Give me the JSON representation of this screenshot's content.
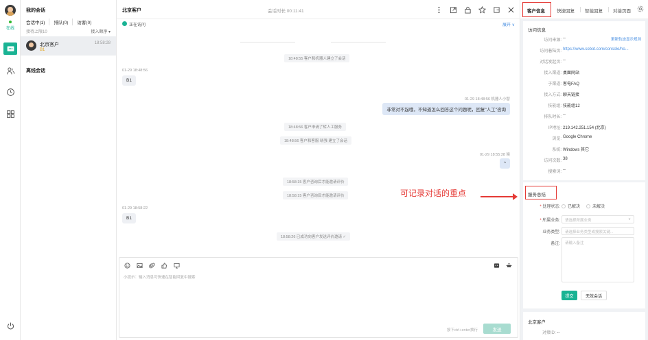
{
  "nav": {
    "status_label": "在线"
  },
  "conversations": {
    "title": "我的会话",
    "tabs": [
      "会话中(1)",
      "排队(0)",
      "访客(0)"
    ],
    "limit": "接待上限10",
    "sort": "接入顺序 ▾",
    "items": [
      {
        "name": "北京客户",
        "message": "B1",
        "time": "18:58:28"
      }
    ],
    "history_title": "离线会话"
  },
  "chat": {
    "customer_name": "北京客户",
    "duration": "会话时长 00:11:41",
    "visit_status": "正在访问",
    "expand": "展开 ∨",
    "separator": "以下为本次消息",
    "messages": {
      "sys1": "18:48:55 客户和机器人建立了会话",
      "ts1": "01-29 18:48:56",
      "b1": "B1",
      "ts_robot": "01-29 18:48:56  机器人小智",
      "robot_msg": "非常对不起哦，不知道怎么回答这个问题呢，回复\"人工\"咨询",
      "sys2": "18:48:56 客户申请了转人工服务",
      "sys3": "18:48:56 客户和客服 晓强 建立了会话",
      "ts_agent": "01-29 18:55:28  晓",
      "agent_msg": "*",
      "sys4": "18:58:15 客户咨询后才能邀请评价",
      "sys5": "18:58:15 客户咨询后才能邀请评价",
      "ts2": "01-29 18:58:22",
      "b2": "B1",
      "sys6": "18:58:26 已成功向客户发送评价邀请 ✓"
    },
    "input_hint": "小提示：输入消息可快速在智能回复中搜索",
    "send_hint": "按下ctrl+enter换行",
    "send_label": "发送"
  },
  "annotation": "可记录对话的重点",
  "right_panel": {
    "tabs": [
      "客户信息",
      "快捷回复",
      "智能回复",
      "对接页面"
    ],
    "visit_title": "访问信息",
    "visit_link": "更新轨迹显示规则",
    "visit_rows": [
      {
        "label": "访问来源:",
        "value": "--"
      },
      {
        "label": "访问着陆页:",
        "value": "https://www.sobot.com/console/ho..."
      },
      {
        "label": "对话发起页:",
        "value": "--"
      },
      {
        "label": "接入渠道:",
        "value": "桌面网站"
      },
      {
        "label": "子渠道:",
        "value": "客电FAQ"
      },
      {
        "label": "接入方式:",
        "value": "聊天链接"
      },
      {
        "label": "技能组:",
        "value": "技能组12"
      },
      {
        "label": "排队时长:",
        "value": "--"
      },
      {
        "label": "IP地址:",
        "value": "219.142.251.154 (北京)"
      },
      {
        "label": "浏览:",
        "value": "Google Chrome"
      },
      {
        "label": "系统:",
        "value": "Windows 其它"
      },
      {
        "label": "访问次数:",
        "value": "38"
      },
      {
        "label": "搜索词:",
        "value": "--"
      }
    ],
    "summary_title": "服务总结",
    "status_label": "处理状态:",
    "status_options": [
      "已解决",
      "未解决"
    ],
    "business_label": "所属业务:",
    "business_placeholder": "请选择所属业务",
    "type_label": "业务类型:",
    "type_placeholder": "请选择业务类型或搜索关键...",
    "note_label": "备注:",
    "note_placeholder": "请输入备注",
    "submit_label": "提交",
    "invalid_label": "无效会话",
    "customer_title": "北京客户",
    "dock_label": "对接ID:",
    "dock_value": "--"
  }
}
